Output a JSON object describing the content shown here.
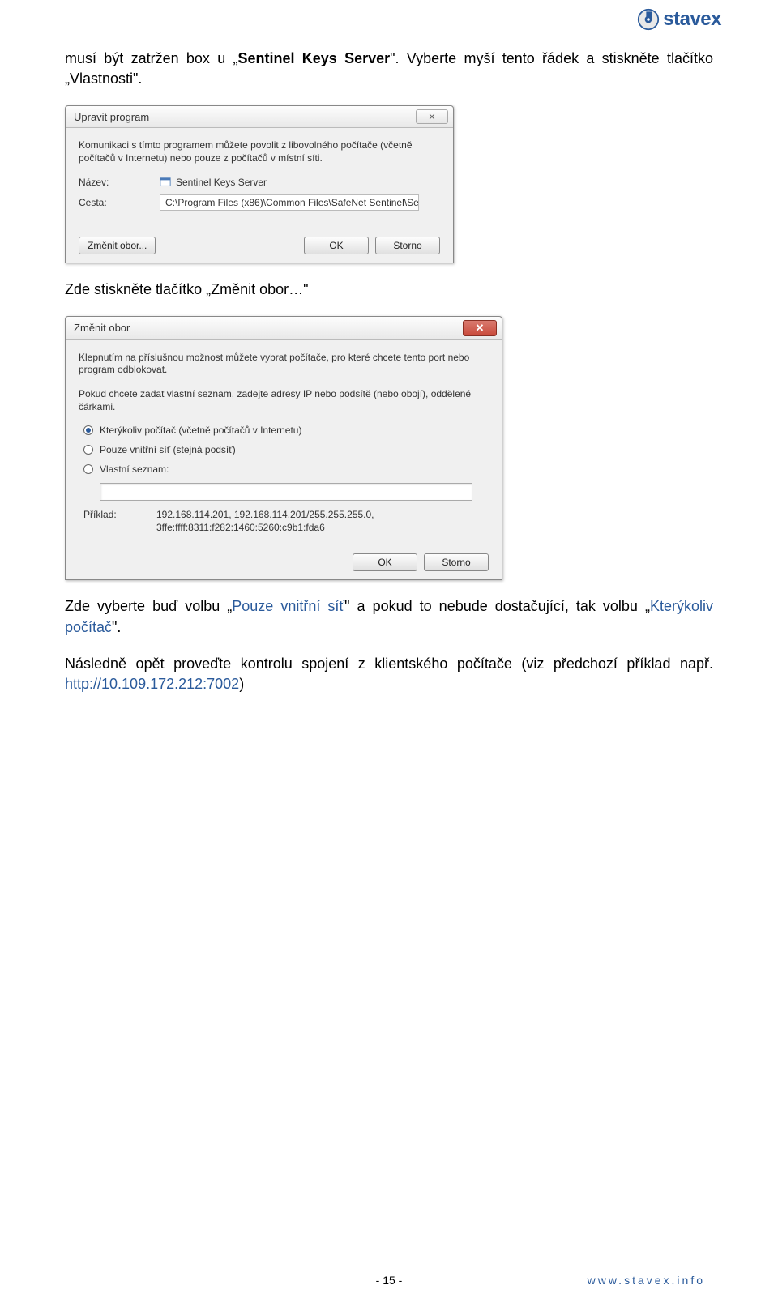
{
  "logo": {
    "text": "stavex"
  },
  "para1": {
    "prefix": "musí být zatržen box u „",
    "bold": "Sentinel Keys Server",
    "suffix": "\". Vyberte myší tento řádek a stiskněte tlačítko „Vlastnosti\"."
  },
  "dialog1": {
    "title": "Upravit program",
    "close_glyph": "✕",
    "text": "Komunikaci s tímto programem můžete povolit z libovolného počítače (včetně počítačů v Internetu) nebo pouze z počítačů v místní síti.",
    "name_label": "Název:",
    "name_value": "Sentinel Keys Server",
    "path_label": "Cesta:",
    "path_value": "C:\\Program Files (x86)\\Common Files\\SafeNet Sentinel\\Se",
    "btn_change": "Změnit obor...",
    "btn_ok": "OK",
    "btn_cancel": "Storno"
  },
  "para2": "Zde stiskněte tlačítko „Změnit obor…\"",
  "dialog2": {
    "title": "Změnit obor",
    "close_glyph": "✕",
    "text1": "Klepnutím na příslušnou možnost můžete vybrat počítače, pro které chcete tento port nebo program odblokovat.",
    "text2": "Pokud chcete zadat vlastní seznam, zadejte adresy IP nebo podsítě (nebo obojí), oddělené čárkami.",
    "radio1": "Kterýkoliv počítač (včetně počítačů v Internetu)",
    "radio2": "Pouze vnitřní síť (stejná podsíť)",
    "radio3": "Vlastní seznam:",
    "example_label": "Příklad:",
    "example_text": "192.168.114.201, 192.168.114.201/255.255.255.0, 3ffe:ffff:8311:f282:1460:5260:c9b1:fda6",
    "btn_ok": "OK",
    "btn_cancel": "Storno"
  },
  "para3": {
    "t1": "Zde vyberte buď volbu „",
    "blue1": "Pouze vnitřní síť",
    "t2": "\" a pokud to nebude dostačující, tak volbu „",
    "blue2": "Kterýkoliv počítač",
    "t3": "\"."
  },
  "para4": {
    "t1": "Následně opět proveďte kontrolu spojení z klientského počítače (viz předchozí příklad např. ",
    "link": "http://10.109.172.212:7002",
    "t2": ")"
  },
  "footer": {
    "page": "- 15 -",
    "site": "www.stavex.info"
  }
}
